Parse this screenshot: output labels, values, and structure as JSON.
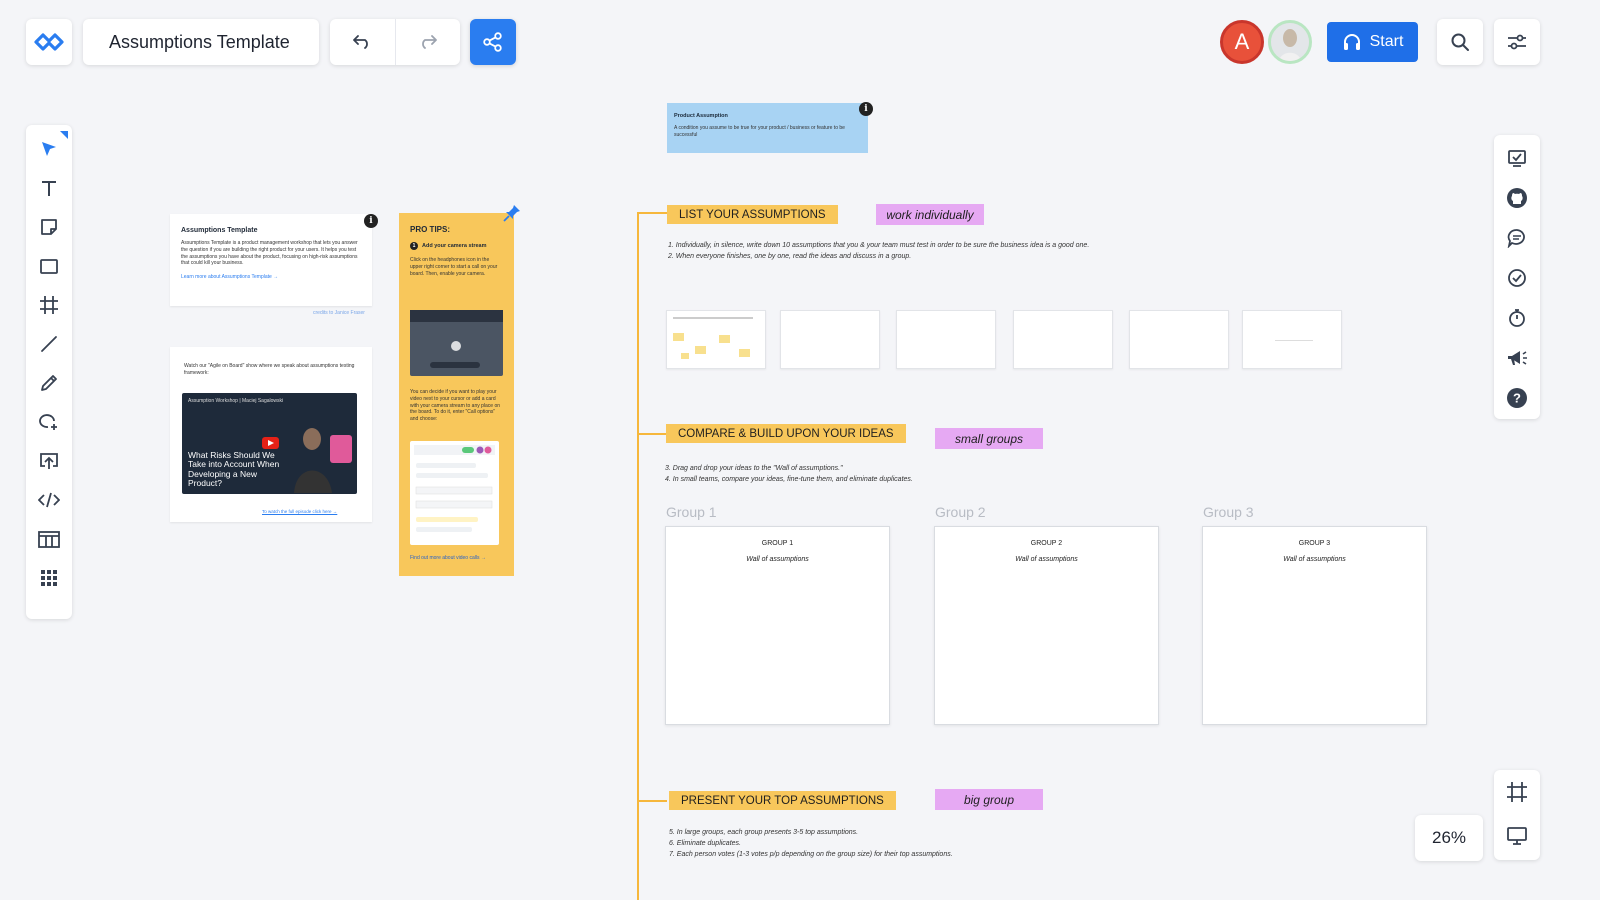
{
  "header": {
    "board_title": "Assumptions Template",
    "start_label": "Start",
    "avatar_initial": "A",
    "accent_color": "#2a7df0"
  },
  "toolbar_left": {
    "tools": [
      "select",
      "text",
      "sticky-note",
      "shape",
      "frame",
      "line",
      "pen",
      "lasso",
      "upload",
      "embed",
      "table",
      "apps"
    ]
  },
  "zoom": {
    "level": "26%"
  },
  "canvas": {
    "product_assumption": {
      "title": "Product Assumption",
      "body": "A condition you assume to be true for your product / business or feature to be successful"
    },
    "info_card": {
      "title": "Assumptions Template",
      "body": "Assumptions Template is a product management workshop that lets you answer the question if you are building the right product for your users. It helps you test the assumptions you have about the product, focusing on high-risk assumptions that could kill your business.",
      "link": "Learn more about Assumptions Template →",
      "credits": "credits to Janice Fraser"
    },
    "video_card": {
      "intro": "Watch our \"Agile on Board\" show where we speak about assumptions testing framework:",
      "channel": "Assumption Workshop | Maciej Sagalowski",
      "thumb_title": "What Risks Should We Take into Account When Developing a New Product?",
      "link": "To watch the full episode click here →"
    },
    "pro_tips": {
      "title": "PRO TIPS:",
      "step_num": "1",
      "step_title": "Add your camera stream",
      "p1": "Click on the headphones icon in the upper right corner to start a call on your board. Then, enable your camera.",
      "p2": "You can decide if you want to play your video next to your cursor or add a card with your camera stream to any place on the board. To do it, enter \"Call options\" and choose:",
      "more": "Find out more about video calls →"
    },
    "section1": {
      "tag": "LIST YOUR ASSUMPTIONS",
      "mode": "work individually",
      "instructions": [
        "1. Individually, in silence, write down 10 assumptions that you & your team must test in order to be sure the business idea is a good one.",
        "2. When everyone finishes, one by one, read the ideas and discuss in a group."
      ]
    },
    "section2": {
      "tag": "COMPARE & BUILD UPON YOUR IDEAS",
      "mode": "small groups",
      "instructions": [
        "3. Drag and drop your ideas to the \"Wall of assumptions.\"",
        "4. In small teams, compare your ideas, fine-tune them, and eliminate duplicates."
      ],
      "groups": [
        {
          "label": "Group 1",
          "title": "GROUP 1",
          "wall": "Wall of assumptions"
        },
        {
          "label": "Group 2",
          "title": "GROUP 2",
          "wall": "Wall of assumptions"
        },
        {
          "label": "Group 3",
          "title": "GROUP 3",
          "wall": "Wall of assumptions"
        }
      ]
    },
    "section3": {
      "tag": "PRESENT YOUR TOP ASSUMPTIONS",
      "mode": "big group",
      "instructions": [
        "5. In large groups, each group presents 3-5 top assumptions.",
        "6. Eliminate duplicates.",
        "7. Each person votes (1-3 votes p/p depending on the group size) for their top assumptions."
      ]
    }
  }
}
